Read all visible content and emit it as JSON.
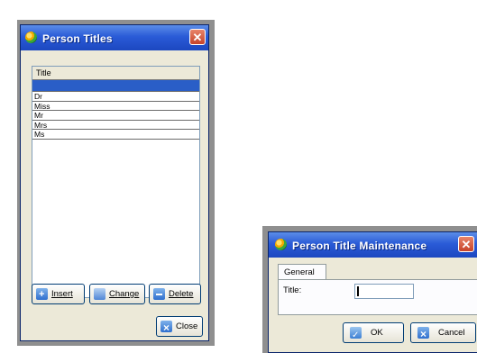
{
  "titles_window": {
    "title": "Person Titles",
    "close_glyph": "✕",
    "grid": {
      "column_header": "Title",
      "rows": [
        "",
        "Dr",
        "Miss",
        "Mr",
        "Mrs",
        "Ms"
      ]
    },
    "buttons": {
      "insert": "Insert",
      "change": "Change",
      "delete": "Delete",
      "close": "Close"
    }
  },
  "maintenance_window": {
    "title": "Person Title Maintenance",
    "close_glyph": "✕",
    "tab": "General",
    "field_label": "Title:",
    "title_value": "",
    "buttons": {
      "ok": "OK",
      "cancel": "Cancel"
    }
  },
  "icons": {
    "app": "app-icon",
    "insert": "plus-icon",
    "change": "edit-icon",
    "delete": "minus-icon",
    "close": "x-icon",
    "ok": "check-icon",
    "cancel": "x-icon"
  },
  "colors": {
    "titlebar": "#2a5bd7",
    "selected_row": "#2a5ec7",
    "window_bg": "#ece9d8",
    "close_button": "#c6432a"
  }
}
